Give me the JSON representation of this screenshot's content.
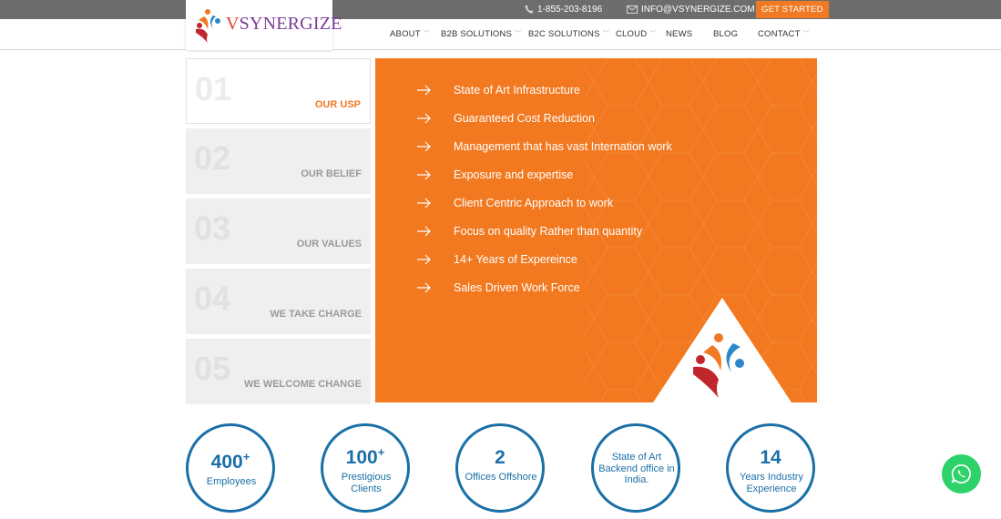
{
  "topbar": {
    "phone": "1-855-203-8196",
    "email": "INFO@VSYNERGIZE.COM",
    "cta": "GET STARTED"
  },
  "logo": {
    "v": "V",
    "rest": "SYNERGIZE"
  },
  "nav": {
    "items": [
      {
        "label": "ABOUT",
        "has_dropdown": true
      },
      {
        "label": "B2B SOLUTIONS",
        "has_dropdown": true
      },
      {
        "label": "B2C SOLUTIONS",
        "has_dropdown": true
      },
      {
        "label": "CLOUD",
        "has_dropdown": true
      },
      {
        "label": "NEWS",
        "has_dropdown": false
      },
      {
        "label": "BLOG",
        "has_dropdown": false
      },
      {
        "label": "CONTACT",
        "has_dropdown": true
      }
    ]
  },
  "tabs": [
    {
      "num": "01",
      "label": "OUR USP",
      "active": true
    },
    {
      "num": "02",
      "label": "OUR BELIEF",
      "active": false
    },
    {
      "num": "03",
      "label": "OUR VALUES",
      "active": false
    },
    {
      "num": "04",
      "label": "WE TAKE CHARGE",
      "active": false
    },
    {
      "num": "05",
      "label": "WE WELCOME CHANGE",
      "active": false
    }
  ],
  "usp": [
    "State of Art Infrastructure",
    "Guaranteed Cost Reduction",
    "Management that has vast Internation work",
    "Exposure and expertise",
    "Client Centric Approach to work",
    "Focus on quality Rather than quantity",
    "14+ Years of Expereince",
    "Sales Driven Work Force"
  ],
  "stats": [
    {
      "num": "400",
      "sup": "+",
      "label": "Employees"
    },
    {
      "num": "100",
      "sup": "+",
      "label": "Prestigious Clients"
    },
    {
      "num": "2",
      "sup": "",
      "label": "Offices Offshore"
    },
    {
      "num": "",
      "sup": "",
      "label": "State of Art Backend office in India."
    },
    {
      "num": "14",
      "sup": "",
      "label": "Years Industry Experience"
    }
  ],
  "colors": {
    "accent": "#f27920",
    "topbar": "#6d6d6d",
    "stat_blue": "#1b6fa8",
    "whatsapp": "#2dd36a"
  },
  "icons": {
    "phone": "phone-icon",
    "mail": "mail-icon",
    "arrow": "arrow-right-icon",
    "whatsapp": "whatsapp-icon"
  }
}
